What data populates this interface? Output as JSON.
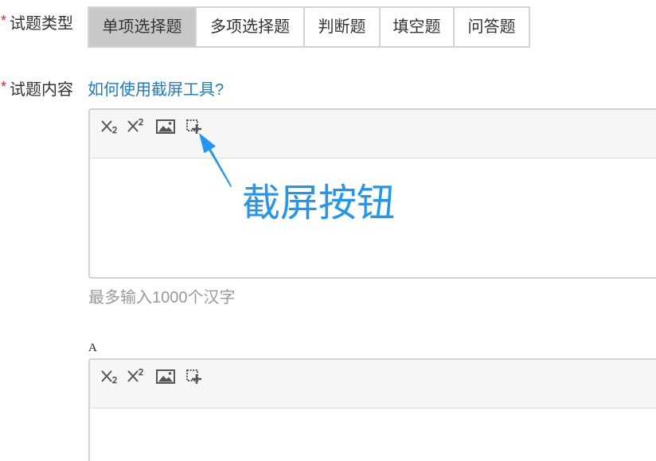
{
  "question_type": {
    "required_mark": "*",
    "label": "试题类型",
    "options": [
      {
        "label": "单项选择题",
        "selected": true
      },
      {
        "label": "多项选择题",
        "selected": false
      },
      {
        "label": "判断题",
        "selected": false
      },
      {
        "label": "填空题",
        "selected": false
      },
      {
        "label": "问答题",
        "selected": false
      }
    ]
  },
  "question_content": {
    "required_mark": "*",
    "label": "试题内容",
    "help_link": "如何使用截屏工具?",
    "toolbar_icons": [
      "subscript-icon",
      "superscript-icon",
      "image-icon",
      "screenshot-icon"
    ],
    "value": "",
    "hint": "最多输入1000个汉字"
  },
  "option_a": {
    "label": "A",
    "toolbar_icons": [
      "subscript-icon",
      "superscript-icon",
      "image-icon",
      "screenshot-icon"
    ],
    "value": ""
  },
  "annotation": {
    "text": "截屏按钮"
  },
  "colors": {
    "required": "#e02b2b",
    "link": "#1a7bd3",
    "selected_tab_bg": "#c8c8c8",
    "tab_border": "#d4d4d4",
    "editor_border": "#d2d2d2",
    "toolbar_bg": "#f6f6f6",
    "icon": "#555555",
    "hint": "#9a9a9a",
    "annotation": "#2196f3"
  }
}
